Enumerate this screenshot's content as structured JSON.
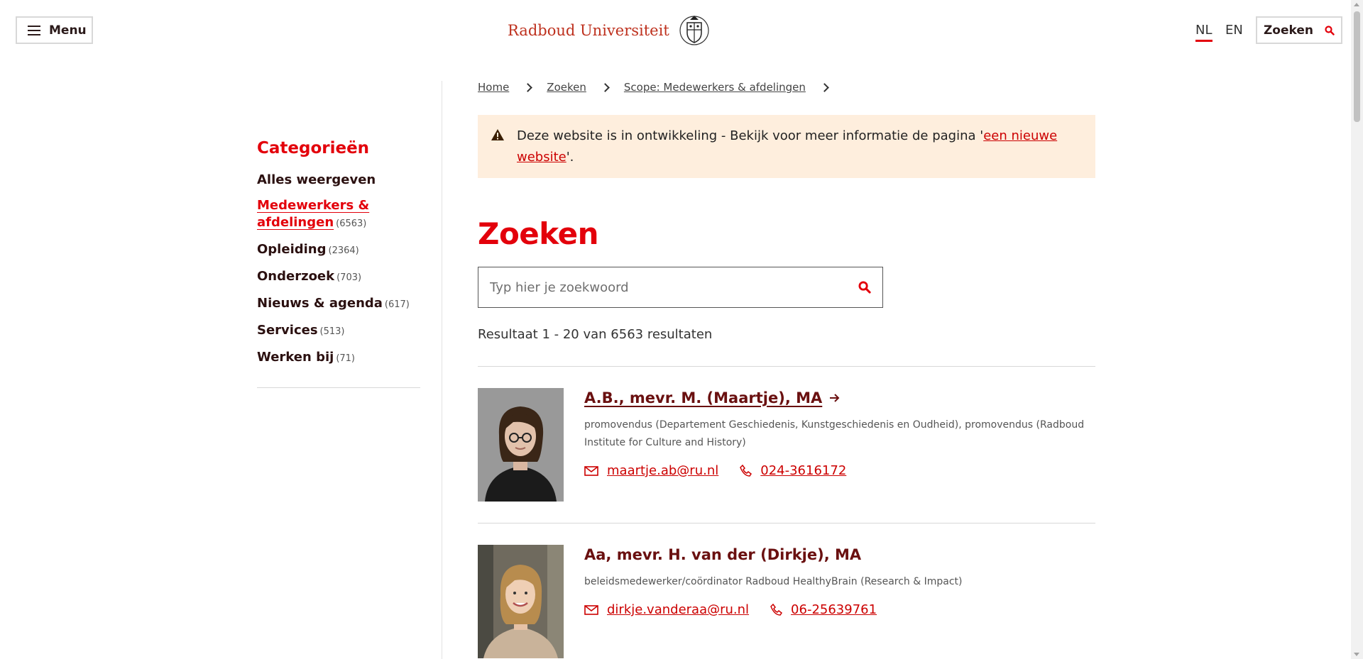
{
  "header": {
    "menu_label": "Menu",
    "logo_text": "Radboud Universiteit",
    "lang_nl": "NL",
    "lang_en": "EN",
    "search_label": "Zoeken",
    "accent": "#e3000b"
  },
  "breadcrumb": [
    "Home",
    "Zoeken",
    "Scope: Medewerkers & afdelingen"
  ],
  "alert": {
    "text_before": "Deze website is in ontwikkeling - Bekijk voor meer informatie de pagina '",
    "link": "een nieuwe website",
    "text_after": "'.",
    "icon": "warning-icon",
    "bg": "#feeedd"
  },
  "sidebar": {
    "title": "Categorieën",
    "items": [
      {
        "label": "Alles weergeven",
        "count": ""
      },
      {
        "label": "Medewerkers & afdelingen",
        "count": "(6563)"
      },
      {
        "label": "Opleiding",
        "count": "(2364)"
      },
      {
        "label": "Onderzoek",
        "count": "(703)"
      },
      {
        "label": "Nieuws & agenda",
        "count": "(617)"
      },
      {
        "label": "Services",
        "count": "(513)"
      },
      {
        "label": "Werken bij",
        "count": "(71)"
      }
    ]
  },
  "main": {
    "title": "Zoeken",
    "search_placeholder": "Typ hier je zoekwoord",
    "result_count": "Resultaat 1 - 20 van 6563 resultaten"
  },
  "results": [
    {
      "name": "A.B., mevr. M. (Maartje), MA",
      "role": "promovendus (Departement Geschiedenis, Kunstgeschiedenis en Oudheid), promovendus (Radboud Institute for Culture and History)",
      "email": "maartje.ab@ru.nl",
      "phone": "024-3616172"
    },
    {
      "name": "Aa, mevr. H. van der (Dirkje), MA",
      "role": "beleidsmedewerker/coördinator Radboud HealthyBrain (Research & Impact)",
      "email": "dirkje.vanderaa@ru.nl",
      "phone": "06-25639761"
    }
  ]
}
